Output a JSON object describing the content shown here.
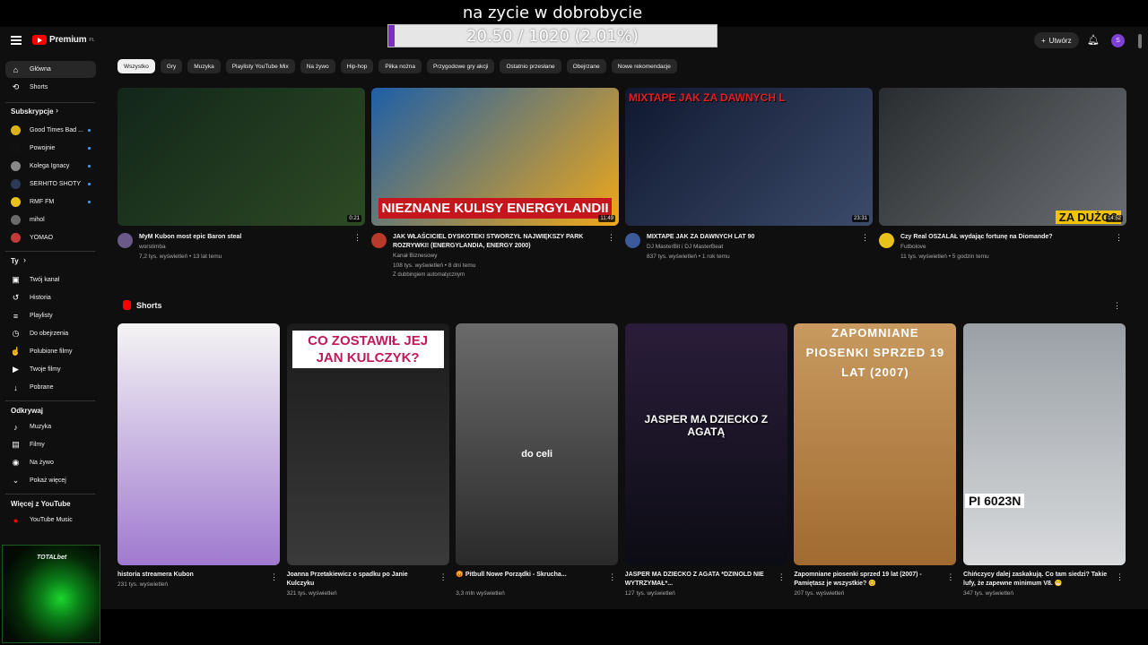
{
  "overlay": {
    "title": "na zycie w dobrobycie",
    "progress_text": "20.50 / 1020 (2.01%)",
    "progress_fraction": 0.0201,
    "fill_color": "#7b2fbf"
  },
  "header": {
    "logo_text": "Premium",
    "logo_region": "PL",
    "create_label": "Utwórz",
    "avatar_letter": "S",
    "icons": [
      "menu-icon",
      "youtube-logo-icon",
      "plus-icon",
      "bell-icon"
    ]
  },
  "sidebar": {
    "main": [
      {
        "label": "Główna",
        "icon": "home-icon",
        "glyph": "⌂"
      },
      {
        "label": "Shorts",
        "icon": "shorts-icon",
        "glyph": "⟲"
      }
    ],
    "subscriptions_title": "Subskrypcje",
    "subscriptions": [
      {
        "label": "Good Times Bad ...",
        "color": "#d9b21a",
        "new": true
      },
      {
        "label": "Powojnie",
        "color": "#111111",
        "new": true
      },
      {
        "label": "Kolega Ignacy",
        "color": "#888888",
        "new": true
      },
      {
        "label": "SERHITO SHOTY",
        "color": "#2b3a55",
        "new": true
      },
      {
        "label": "RMF FM",
        "color": "#e6c21b",
        "new": true
      },
      {
        "label": "mihol",
        "color": "#6a6a6a",
        "new": false
      },
      {
        "label": "YOMAO",
        "color": "#c43a3a",
        "new": false
      }
    ],
    "you_title": "Ty",
    "you": [
      {
        "label": "Twój kanał",
        "icon": "channel-icon",
        "glyph": "▣"
      },
      {
        "label": "Historia",
        "icon": "history-icon",
        "glyph": "↺"
      },
      {
        "label": "Playlisty",
        "icon": "playlist-icon",
        "glyph": "≡"
      },
      {
        "label": "Do obejrzenia",
        "icon": "clock-icon",
        "glyph": "◷"
      },
      {
        "label": "Polubione filmy",
        "icon": "thumbs-up-icon",
        "glyph": "☝"
      },
      {
        "label": "Twoje filmy",
        "icon": "video-icon",
        "glyph": "▶"
      },
      {
        "label": "Pobrane",
        "icon": "download-icon",
        "glyph": "↓"
      }
    ],
    "explore_title": "Odkrywaj",
    "explore": [
      {
        "label": "Muzyka",
        "icon": "music-icon",
        "glyph": "♪"
      },
      {
        "label": "Filmy",
        "icon": "film-icon",
        "glyph": "▤"
      },
      {
        "label": "Na żywo",
        "icon": "live-icon",
        "glyph": "◉"
      },
      {
        "label": "Pokaż więcej",
        "icon": "chevron-down-icon",
        "glyph": "⌄"
      }
    ],
    "more_title": "Więcej z YouTube",
    "more": [
      {
        "label": "YouTube Music",
        "icon": "youtube-music-icon",
        "glyph": "●"
      }
    ],
    "ad_text": "TOTALbet"
  },
  "chips": [
    "Wszystko",
    "Gry",
    "Muzyka",
    "Playlisty YouTube Mix",
    "Na żywo",
    "Hip-hop",
    "Piłka nożna",
    "Przygodowe gry akcji",
    "Ostatnio przesłane",
    "Obejrzane",
    "Nowe rekomendacje"
  ],
  "videos": [
    {
      "title": "MyM Kubon most epic Baron steal",
      "channel": "worstimba",
      "stats": "7,2 tys. wyświetleń • 13 lat temu",
      "duration": "0:21",
      "extra": "",
      "thumb_text": "",
      "colors": [
        "#12261a",
        "#2d4a24"
      ],
      "avatar": "#6a5a8a"
    },
    {
      "title": "JAK WŁAŚCICIEL DYSKOTEKI STWORZYŁ NAJWIĘKSZY PARK ROZRYWKI! (ENERGYLANDIA, ENERGY 2000)",
      "channel": "Kanał Biznesowy",
      "stats": "108 tys. wyświetleń • 8 dni temu",
      "duration": "11:49",
      "extra": "Z dubbingiem automatycznym",
      "thumb_text": "NIEZNANE KULISY ENERGYLANDII",
      "colors": [
        "#1d5fa8",
        "#f0a818"
      ],
      "avatar": "#b83a2a"
    },
    {
      "title": "MIXTAPE JAK ZA DAWNYCH LAT 90",
      "channel": "DJ MasterBit i DJ MasterBeat",
      "stats": "837 tys. wyświetleń • 1 rok temu",
      "duration": "23:31",
      "extra": "",
      "thumb_text": "MIXTAPE JAK ZA DAWNYCH L",
      "colors": [
        "#101830",
        "#3b4b6a"
      ],
      "avatar": "#3a5a9a"
    },
    {
      "title": "Czy Real OSZALAŁ wydając fortunę na Diomande?",
      "channel": "Futbolove",
      "stats": "11 tys. wyświetleń • 5 godzin temu",
      "duration": "14:52",
      "extra": "",
      "thumb_text": "ZA DUŻO?",
      "colors": [
        "#2a2d30",
        "#6a6e72"
      ],
      "avatar": "#e6c21b"
    }
  ],
  "shorts_title": "Shorts",
  "shorts": [
    {
      "title": "historia streamera Kubon",
      "views": "231 tys. wyświetleń",
      "thumb_text": "",
      "colors": [
        "#f4f4f4",
        "#a07ad0"
      ]
    },
    {
      "title": "Joanna Przetakiewicz o spadku po Janie Kulczyku",
      "views": "321 tys. wyświetleń",
      "thumb_text": "CO ZOSTAWIŁ JEJ JAN KULCZYK?",
      "colors": [
        "#1b1b1b",
        "#3a3a3a"
      ]
    },
    {
      "title": "😡 Pitbull Nowe Porządki - Skrucha...",
      "views": "3,3 mln wyświetleń",
      "thumb_text": "do celi",
      "colors": [
        "#6a6a6a",
        "#2a2a2a"
      ]
    },
    {
      "title": "JASPER MA DZIECKO Z AGATA *DZINOLD NIE WYTRZYMAŁ*...",
      "views": "127 tys. wyświetleń",
      "thumb_text": "JASPER MA DZIECKO Z AGATĄ",
      "colors": [
        "#2a1d3a",
        "#0c0c14"
      ]
    },
    {
      "title": "Zapomniane piosenki sprzed 19 lat (2007) - Pamiętasz je wszystkie? 😊",
      "views": "207 tys. wyświetleń",
      "thumb_text": "ZAPOMNIANE PIOSENKI SPRZED 19 LAT (2007)",
      "colors": [
        "#c89a60",
        "#a06a30"
      ]
    },
    {
      "title": "Chińczycy dalej zaskakują. Co tam siedzi? Takie lufy, że zapewne minimum V8. 😁",
      "views": "347 tys. wyświetleń",
      "thumb_text": "PI 6023N",
      "colors": [
        "#9aa0a6",
        "#d8dadc"
      ]
    }
  ]
}
